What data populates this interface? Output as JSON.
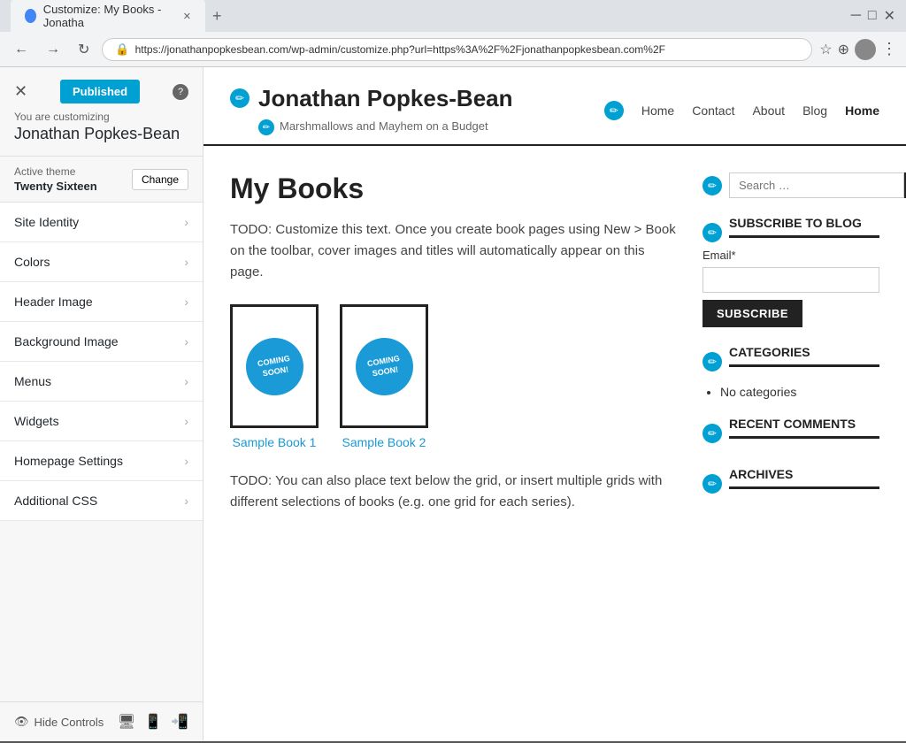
{
  "browser": {
    "tab_title": "Customize: My Books - Jonatha",
    "tab_favicon": "●",
    "url": "https://jonathanpopkesbean.com/wp-admin/customize.php?url=https%3A%2F%2Fjonathanpopkesbean.com%2F",
    "new_tab_icon": "+"
  },
  "sidebar": {
    "close_label": "✕",
    "publish_label": "Published",
    "customizing_text": "You are customizing",
    "site_name": "Jonathan Popkes-Bean",
    "active_theme_label": "Active theme",
    "active_theme_name": "Twenty Sixteen",
    "change_label": "Change",
    "help_icon": "?",
    "menu_items": [
      {
        "id": "site-identity",
        "label": "Site Identity"
      },
      {
        "id": "colors",
        "label": "Colors"
      },
      {
        "id": "header-image",
        "label": "Header Image"
      },
      {
        "id": "background-image",
        "label": "Background Image"
      },
      {
        "id": "menus",
        "label": "Menus"
      },
      {
        "id": "widgets",
        "label": "Widgets"
      },
      {
        "id": "homepage-settings",
        "label": "Homepage Settings"
      },
      {
        "id": "additional-css",
        "label": "Additional CSS"
      }
    ],
    "hide_controls_label": "Hide Controls"
  },
  "site": {
    "title": "Jonathan Popkes-Bean",
    "tagline": "Marshmallows and Mayhem on a Budget",
    "nav": [
      {
        "label": "Home",
        "active": false
      },
      {
        "label": "Contact",
        "active": false
      },
      {
        "label": "About",
        "active": false
      },
      {
        "label": "Blog",
        "active": false
      },
      {
        "label": "Home",
        "active": true
      }
    ]
  },
  "main_content": {
    "page_title": "My Books",
    "intro_text": "TODO: Customize this text. Once you create book pages using New > Book on the toolbar, cover images and titles will automatically appear on this page.",
    "books": [
      {
        "id": "book-1",
        "label": "Sample Book 1",
        "badge": "COMING\nSOON!"
      },
      {
        "id": "book-2",
        "label": "Sample Book 2",
        "badge": "COMING\nSOON!"
      }
    ],
    "footer_text": "TODO: You can also place text below the grid, or insert multiple grids with different selections of books (e.g. one grid for each series)."
  },
  "widgets": {
    "search_placeholder": "Search …",
    "search_button": "🔍",
    "subscribe_title": "SUBSCRIBE TO BLOG",
    "email_label": "Email*",
    "subscribe_button": "SUBSCRIBE",
    "categories_title": "CATEGORIES",
    "categories_items": [
      "No categories"
    ],
    "recent_comments_title": "RECENT COMMENTS",
    "archives_title": "ARCHIVES"
  }
}
